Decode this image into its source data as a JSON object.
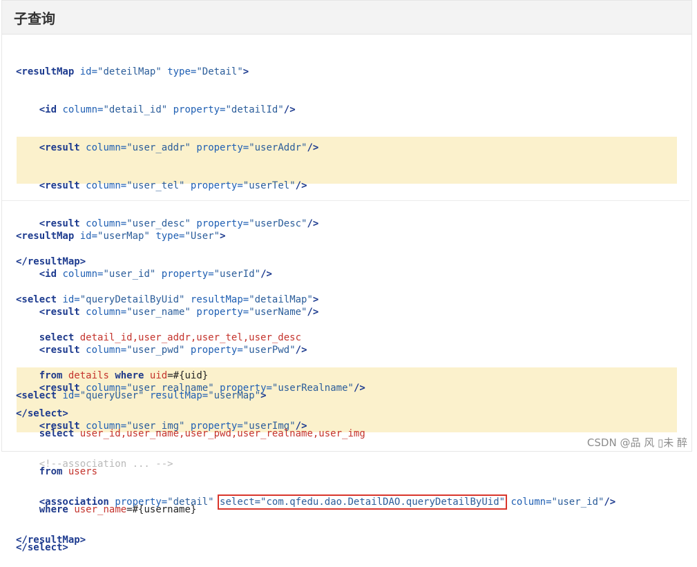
{
  "title": "子查询",
  "block1": {
    "l1": {
      "open": "<resultMap",
      "a1": "id=",
      "v1": "\"deteilMap\"",
      "a2": "type=",
      "v2": "\"Detail\"",
      "close": ">"
    },
    "l2": {
      "open": "<id",
      "a1": "column=",
      "v1": "\"detail_id\"",
      "a2": "property=",
      "v2": "\"detailId\"",
      "close": "/>"
    },
    "l3": {
      "open": "<result",
      "a1": "column=",
      "v1": "\"user_addr\"",
      "a2": "property=",
      "v2": "\"userAddr\"",
      "close": "/>"
    },
    "l4": {
      "open": "<result",
      "a1": "column=",
      "v1": "\"user_tel\"",
      "a2": "property=",
      "v2": "\"userTel\"",
      "close": "/>"
    },
    "l5": {
      "open": "<result",
      "a1": "column=",
      "v1": "\"user_desc\"",
      "a2": "property=",
      "v2": "\"userDesc\"",
      "close": "/>"
    },
    "l6": "</resultMap>",
    "l7": {
      "open": "<select",
      "a1": "id=",
      "v1": "\"queryDetailByUid\"",
      "a2": "resultMap=",
      "v2": "\"detailMap\"",
      "close": ">"
    },
    "l8": {
      "kw": "select",
      "cols": "detail_id,user_addr,user_tel,user_desc"
    },
    "l9": {
      "kw1": "from",
      "tbl": "details",
      "kw2": "where",
      "cond": "uid",
      "rest": "=#{uid}"
    },
    "l10": "</select>"
  },
  "block2": {
    "l1": {
      "open": "<resultMap",
      "a1": "id=",
      "v1": "\"userMap\"",
      "a2": "type=",
      "v2": "\"User\"",
      "close": ">"
    },
    "l2": {
      "open": "<id",
      "a1": "column=",
      "v1": "\"user_id\"",
      "a2": "property=",
      "v2": "\"userId\"",
      "close": "/>"
    },
    "l3": {
      "open": "<result",
      "a1": "column=",
      "v1": "\"user_name\"",
      "a2": "property=",
      "v2": "\"userName\"",
      "close": "/>"
    },
    "l4": {
      "open": "<result",
      "a1": "column=",
      "v1": "\"user_pwd\"",
      "a2": "property=",
      "v2": "\"userPwd\"",
      "close": "/>"
    },
    "l5": {
      "open": "<result",
      "a1": "column=",
      "v1": "\"user_realname\"",
      "a2": "property=",
      "v2": "\"userRealname\"",
      "close": "/>"
    },
    "l6": {
      "open": "<result",
      "a1": "column=",
      "v1": "\"user_img\"",
      "a2": "property=",
      "v2": "\"userImg\"",
      "close": "/>"
    },
    "l7": "<!--association ... -->",
    "l8": {
      "open": "<association",
      "a1": "property=",
      "v1": "\"detail\"",
      "sel": "select=\"com.qfedu.dao.DetailDAO.queryDetailByUid\"",
      "a2": "column=",
      "v2": "\"user_id\"",
      "close": "/>"
    },
    "l9": "</resultMap>"
  },
  "block3": {
    "l1": {
      "open": "<select",
      "a1": "id=",
      "v1": "\"queryUser\"",
      "a2": "resultMap=",
      "v2": "\"userMap\"",
      "close": ">"
    },
    "l2": {
      "kw": "select",
      "cols": "user_id,user_name,user_pwd,user_realname,user_img"
    },
    "l3": {
      "kw": "from",
      "tbl": "users"
    },
    "l4": {
      "kw": "where",
      "cond": "user_name",
      "rest": "=#{username}"
    },
    "l5": "</select>"
  },
  "watermark": "CSDN @品 风 ▯未 醉"
}
